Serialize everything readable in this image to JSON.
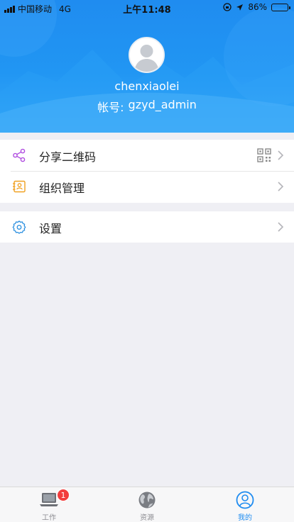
{
  "status_bar": {
    "carrier": "中国移动",
    "network": "4G",
    "time": "上午11:48",
    "battery": "86%",
    "battery_level": 0.86
  },
  "profile": {
    "username": "chenxiaolei",
    "account_label": "帐号:",
    "account_value": "gzyd_admin"
  },
  "menu": {
    "share_qr": "分享二维码",
    "org_manage": "组织管理",
    "settings": "设置"
  },
  "tabbar": {
    "tabs": [
      {
        "label": "工作",
        "icon": "laptop-icon",
        "badge": "1"
      },
      {
        "label": "资源",
        "icon": "globe-icon"
      },
      {
        "label": "我的",
        "icon": "user-icon"
      }
    ],
    "active": "我的"
  },
  "colors": {
    "primary": "#2196f3",
    "badge": "#f23d3d",
    "background": "#efeff4"
  }
}
